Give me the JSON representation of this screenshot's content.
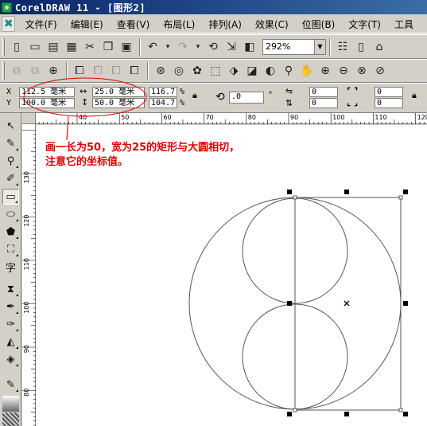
{
  "window": {
    "title": "CorelDRAW 11 - [图形2]"
  },
  "menu": {
    "logo_icon": "coreldraw-logo-icon",
    "items": [
      "文件(F)",
      "编辑(E)",
      "查看(V)",
      "布局(L)",
      "排列(A)",
      "效果(C)",
      "位图(B)",
      "文字(T)",
      "工具"
    ]
  },
  "toolbar": {
    "zoom_value": "292%"
  },
  "property_bar": {
    "x_label": "X",
    "y_label": "Y",
    "x_value": "112.5 毫米",
    "y_value": "100.0 毫米",
    "width_value": "25.0 毫米",
    "height_value": "50.0 毫米",
    "scale_x": "116.7",
    "scale_y": "104.7",
    "percent": "%",
    "rotation": ".0",
    "degree": "°",
    "corner_values": [
      "0",
      "0",
      "0",
      "0"
    ]
  },
  "ruler": {
    "h_labels": [
      "40",
      "50",
      "60",
      "70",
      "80",
      "90",
      "100",
      "110",
      "120"
    ],
    "v_labels": [
      "130",
      "120",
      "110",
      "100",
      "90",
      "80"
    ]
  },
  "annotation": {
    "line1": "画一长为50，宽为25的矩形与大圆相切，",
    "line2": "注意它的坐标值。"
  },
  "colors": {
    "annotation": "#e00000",
    "title_bar": "#0a246a"
  }
}
